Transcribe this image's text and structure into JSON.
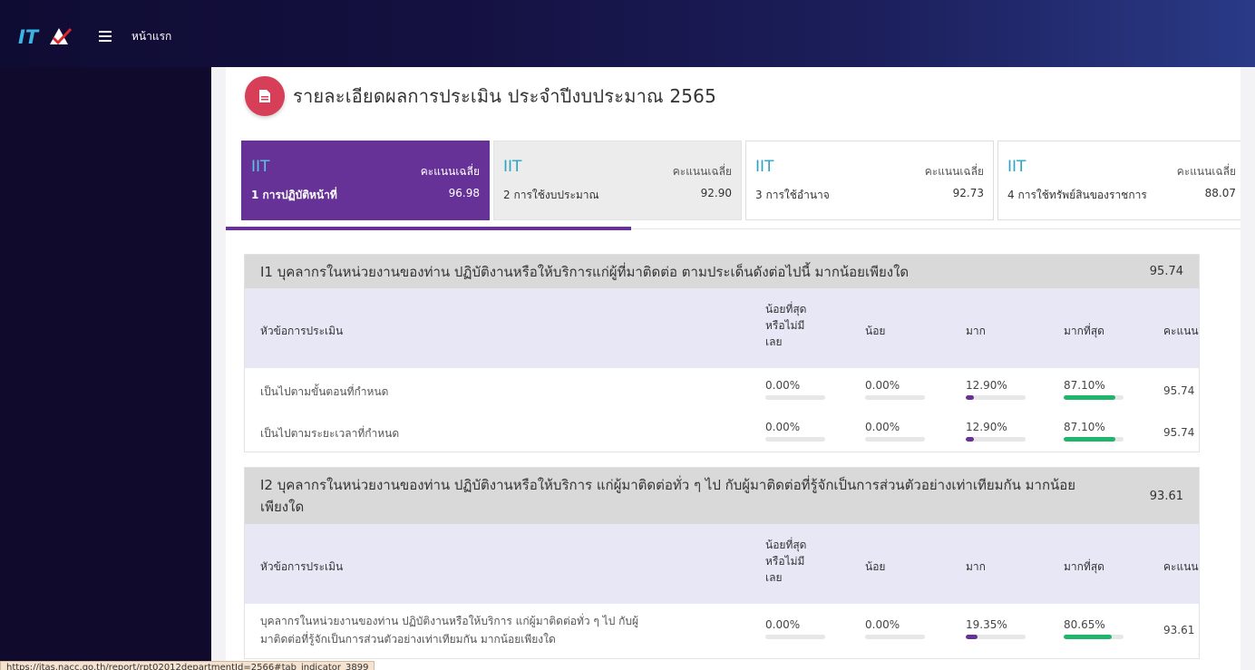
{
  "topbar": {
    "logo_text": "ITA",
    "home_label": "หน้าแรก"
  },
  "page": {
    "title": "รายละเอียดผลการประเมิน ประจำปีงบประมาณ 2565"
  },
  "tabs": [
    {
      "code": "IIT",
      "avg_label": "คะแนนเฉลี่ย",
      "name": "1 การปฏิบัติหน้าที่",
      "score": "96.98"
    },
    {
      "code": "IIT",
      "avg_label": "คะแนนเฉลี่ย",
      "name": "2 การใช้งบประมาณ",
      "score": "92.90"
    },
    {
      "code": "IIT",
      "avg_label": "คะแนนเฉลี่ย",
      "name": "3 การใช้อำนาจ",
      "score": "92.73"
    },
    {
      "code": "IIT",
      "avg_label": "คะแนนเฉลี่ย",
      "name": "4 การใช้ทรัพย์สินของราชการ",
      "score": "88.07"
    }
  ],
  "columns": {
    "topic": "หัวข้อการประเมิน",
    "least_1": "น้อยที่สุด",
    "least_2": "หรือไม่มี",
    "least_3": "เลย",
    "less": "น้อย",
    "more": "มาก",
    "most": "มากที่สุด",
    "score": "คะแนน"
  },
  "colors": {
    "purple": "#673297",
    "green": "#1fb56a",
    "accent_red": "#d63f57"
  },
  "sections": [
    {
      "question": "I1 บุคลากรในหน่วยงานของท่าน ปฏิบัติงานหรือให้บริการแก่ผู้ที่มาติดต่อ ตามประเด็นดังต่อไปนี้ มากน้อยเพียงใด",
      "score": "95.74",
      "rows": [
        {
          "topic": "เป็นไปตามขั้นตอนที่กำหนด",
          "least": "0.00%",
          "less": "0.00%",
          "more": "12.90%",
          "most": "87.10%",
          "score": "95.74",
          "more_frac": 0.129,
          "most_frac": 0.871
        },
        {
          "topic": "เป็นไปตามระยะเวลาที่กำหนด",
          "least": "0.00%",
          "less": "0.00%",
          "more": "12.90%",
          "most": "87.10%",
          "score": "95.74",
          "more_frac": 0.129,
          "most_frac": 0.871
        }
      ]
    },
    {
      "question_1": "I2 บุคลากรในหน่วยงานของท่าน ปฏิบัติงานหรือให้บริการ แก่ผู้มาติดต่อทั่ว ๆ ไป กับผู้มาติดต่อที่รู้จักเป็นการส่วนตัวอย่างเท่าเทียมกัน มากน้อย",
      "question_2": "เพียงใด",
      "score": "93.61",
      "rows": [
        {
          "topic_1": "บุคลากรในหน่วยงานของท่าน ปฏิบัติงานหรือให้บริการ แก่ผู้มาติดต่อทั่ว ๆ ไป กับผู้",
          "topic_2": "มาติดต่อที่รู้จักเป็นการส่วนตัวอย่างเท่าเทียมกัน มากน้อยเพียงใด",
          "least": "0.00%",
          "less": "0.00%",
          "more": "19.35%",
          "most": "80.65%",
          "score": "93.61",
          "more_frac": 0.1935,
          "most_frac": 0.8065
        }
      ]
    }
  ],
  "status_url": "https://itas.nacc.go.th/report/rpt02012departmentId=2566#tab_indicator_3899"
}
